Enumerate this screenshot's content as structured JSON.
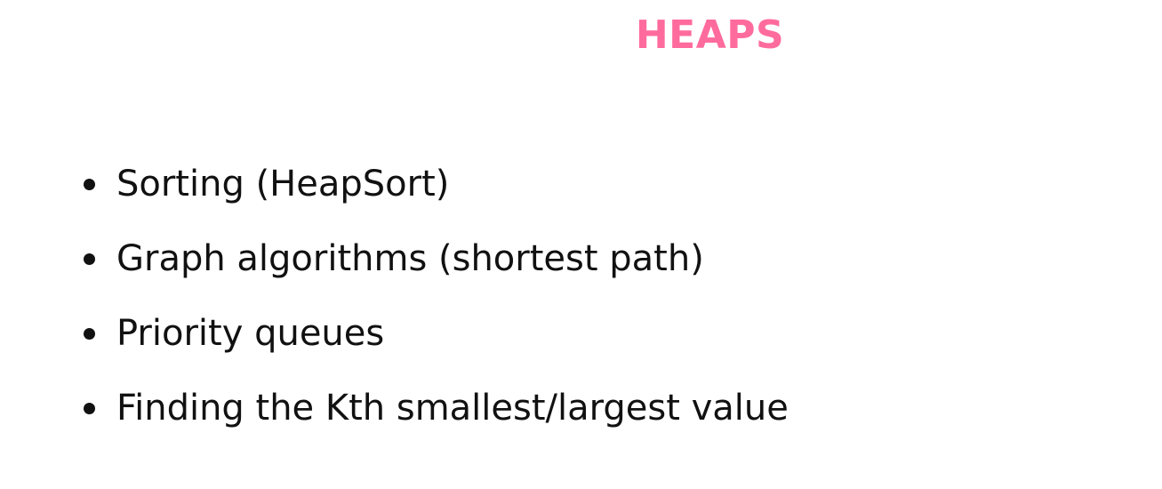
{
  "slide": {
    "title": "HEAPS",
    "bullets": [
      "Sorting (HeapSort)",
      "Graph algorithms (shortest path)",
      "Priority queues",
      "Finding the Kth smallest/largest value"
    ]
  },
  "colors": {
    "title": "#ff6b9d",
    "text": "#111111",
    "background": "#ffffff"
  }
}
